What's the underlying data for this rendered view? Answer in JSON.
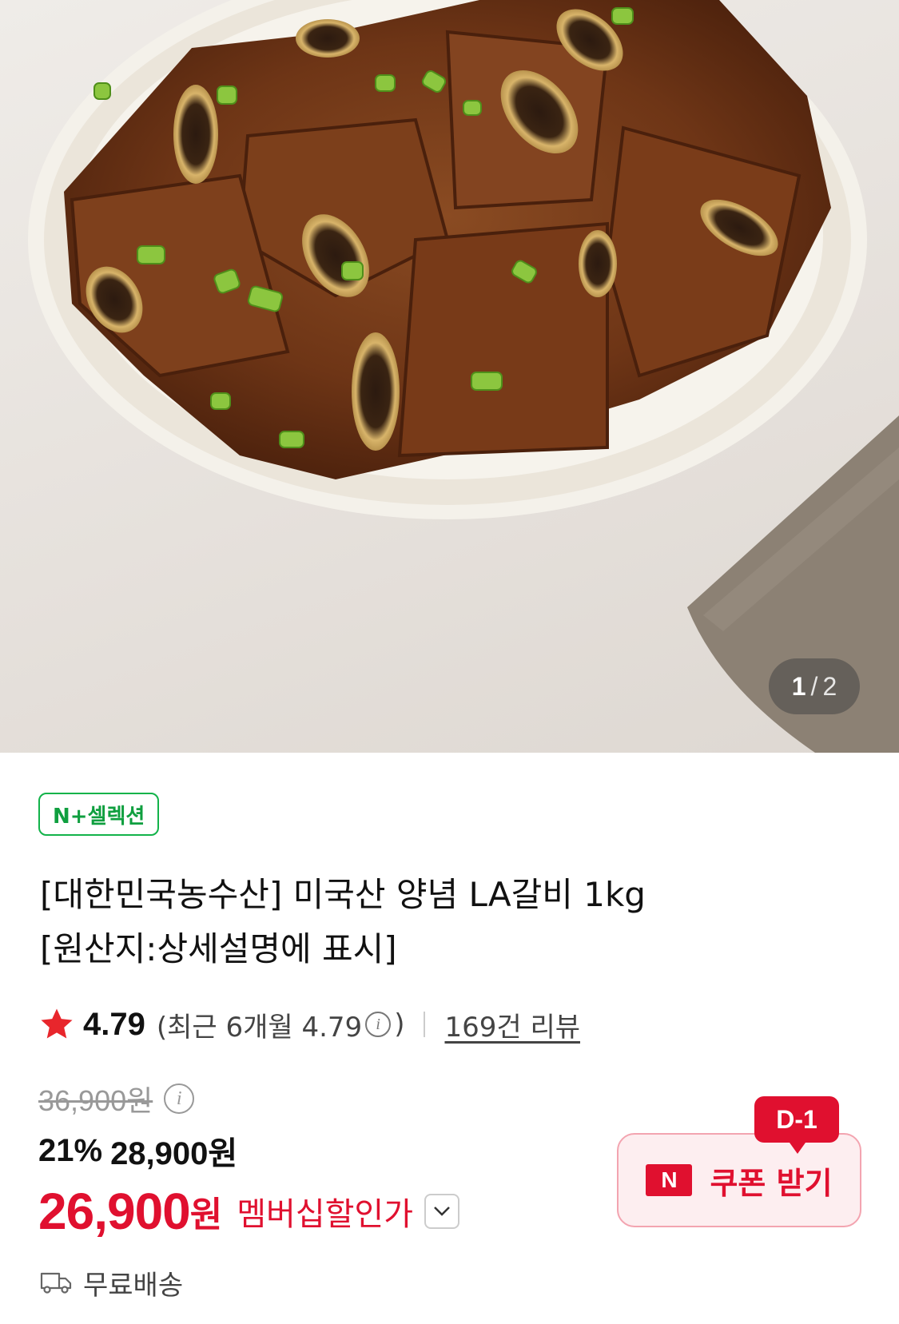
{
  "gallery": {
    "current": "1",
    "separator": "/",
    "total": "2"
  },
  "badge": "N+셀렉션",
  "product": {
    "title_line1": "[대한민국농수산] 미국산 양념 LA갈비 1kg",
    "title_line2": "[원산지:상세설명에 표시]"
  },
  "rating": {
    "score": "4.79",
    "recent_prefix": "(최근 6개월 4.79",
    "recent_suffix": ")",
    "reviews": "169건 리뷰"
  },
  "price": {
    "original": "36,900원",
    "discount_pct": "21%",
    "sale": "28,900원",
    "member_price": "26,900",
    "member_won": "원",
    "member_label": "멤버십할인가"
  },
  "coupon": {
    "logo": "N",
    "label": "쿠폰 받기",
    "dday": "D-1"
  },
  "shipping": "무료배송",
  "colors": {
    "accent": "#e0102f",
    "badge_green": "#12b34a"
  },
  "icons": [
    "star-icon",
    "info-icon",
    "chevron-down-icon",
    "truck-icon",
    "naver-n-icon"
  ]
}
